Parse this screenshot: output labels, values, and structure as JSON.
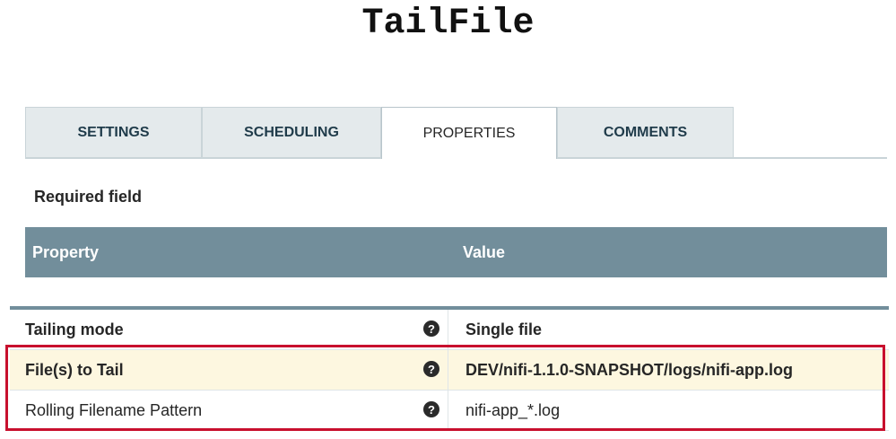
{
  "title": "TailFile",
  "tabs": [
    {
      "label": "SETTINGS",
      "active": false
    },
    {
      "label": "SCHEDULING",
      "active": false
    },
    {
      "label": "PROPERTIES",
      "active": true
    },
    {
      "label": "COMMENTS",
      "active": false
    }
  ],
  "required_label": "Required field",
  "table": {
    "header_property": "Property",
    "header_value": "Value",
    "help_icon_glyph": "?",
    "rows": [
      {
        "name": "Tailing mode",
        "value": "Single file",
        "required": true
      },
      {
        "name": "File(s) to Tail",
        "value": "DEV/nifi-1.1.0-SNAPSHOT/logs/nifi-app.log",
        "required": true,
        "highlighted": true
      },
      {
        "name": "Rolling Filename Pattern",
        "value": "nifi-app_*.log",
        "required": false
      }
    ]
  },
  "colors": {
    "header_bg": "#728e9b",
    "tab_bg": "#e4eaec",
    "highlight_row": "#fdf7e0",
    "annotation_border": "#c8102e"
  }
}
